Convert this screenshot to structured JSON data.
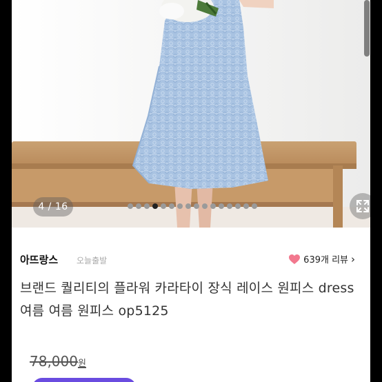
{
  "gallery": {
    "counter": "4 / 16",
    "dot_count": 16,
    "active_dot": 4
  },
  "shop": {
    "name": "아뜨랑스",
    "shipping_tag": "오늘출발",
    "reviews": "639개 리뷰",
    "reviews_chevron": "›"
  },
  "product": {
    "title": "브랜드 퀄리티의 플라워 카라타이 장식 레이스 원피스 dress 여름 여름 원피스 op5125",
    "original_price": "78,000",
    "price_unit": "원"
  },
  "icons": {
    "heart": "heart-icon",
    "expand": "expand-icon",
    "chevron": "chevron-right-icon"
  },
  "colors": {
    "heart": "#f2788e",
    "accent": "#6a4ce0",
    "dress": "#a9c3e2"
  }
}
